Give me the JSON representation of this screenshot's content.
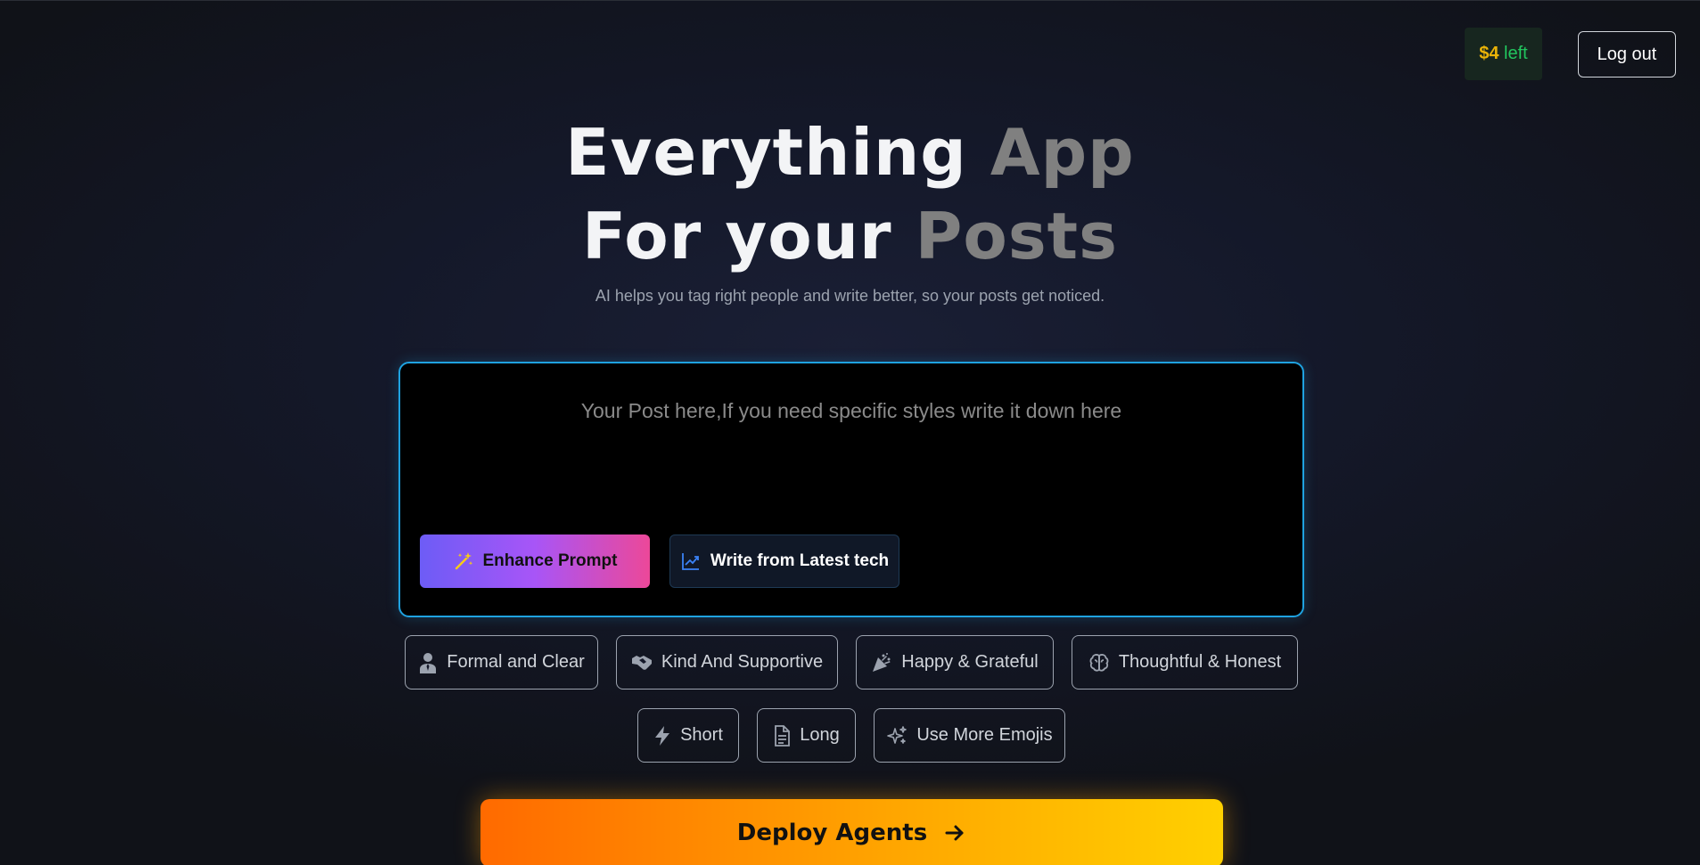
{
  "header": {
    "credits_amount": "$4",
    "credits_suffix": " left",
    "logout_label": "Log out"
  },
  "hero": {
    "line1_white": "Everything ",
    "line1_gray": "App",
    "line2_white": "For your ",
    "line2_gray": "Posts",
    "subtitle": "AI helps you tag right people and write better, so your posts get noticed."
  },
  "composer": {
    "placeholder": "Your Post here,If you need specific styles write it down here",
    "value": "",
    "enhance_label": "Enhance Prompt",
    "enhance_icon": "magic-wand-icon",
    "latest_label": "Write from Latest tech",
    "latest_icon": "trending-up-icon"
  },
  "tones": [
    {
      "label": "Formal and Clear",
      "icon": "person-tie-icon"
    },
    {
      "label": "Kind And Supportive",
      "icon": "handshake-icon"
    },
    {
      "label": "Happy & Grateful",
      "icon": "party-popper-icon"
    },
    {
      "label": "Thoughtful & Honest",
      "icon": "brain-icon"
    }
  ],
  "lengths": [
    {
      "label": "Short",
      "icon": "lightning-icon"
    },
    {
      "label": "Long",
      "icon": "document-icon"
    },
    {
      "label": "Use More Emojis",
      "icon": "sparkles-icon"
    }
  ],
  "deploy_label": "Deploy Agents",
  "colors": {
    "composer_border": "#1fa2e0",
    "credits_green": "#22c55e",
    "credits_gold": "#eab308",
    "enhance_gradient": [
      "#6d5cf6",
      "#a855f7",
      "#ec4899"
    ],
    "deploy_gradient": [
      "#ff6a00",
      "#ffa500",
      "#ffd000"
    ]
  }
}
